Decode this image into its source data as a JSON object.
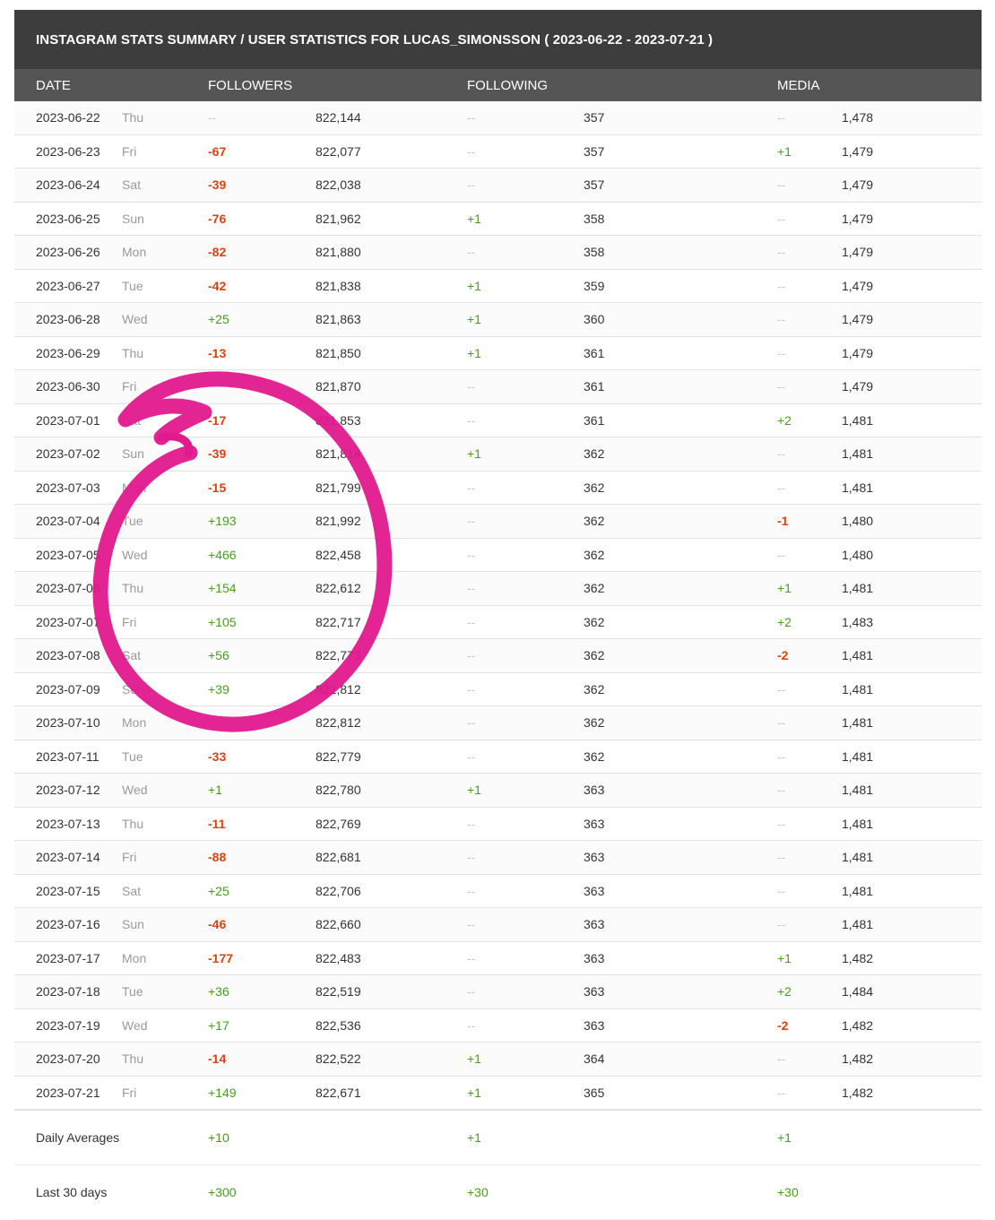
{
  "title": "INSTAGRAM STATS SUMMARY / USER STATISTICS FOR LUCAS_SIMONSSON ( 2023-06-22 - 2023-07-21 )",
  "columns": {
    "date": "DATE",
    "followers": "FOLLOWERS",
    "following": "FOLLOWING",
    "media": "MEDIA"
  },
  "colors": {
    "positive": "#43a214",
    "negative": "#e2400c",
    "header_bg": "#3d3d3d",
    "subheader_bg": "#555555",
    "annotation": "#e0198d"
  },
  "rows": [
    {
      "date": "2023-06-22",
      "day": "Thu",
      "f_chg": "--",
      "f_val": "822,144",
      "g_chg": "--",
      "g_val": "357",
      "m_chg": "--",
      "m_val": "1,478"
    },
    {
      "date": "2023-06-23",
      "day": "Fri",
      "f_chg": "-67",
      "f_val": "822,077",
      "g_chg": "--",
      "g_val": "357",
      "m_chg": "+1",
      "m_val": "1,479"
    },
    {
      "date": "2023-06-24",
      "day": "Sat",
      "f_chg": "-39",
      "f_val": "822,038",
      "g_chg": "--",
      "g_val": "357",
      "m_chg": "--",
      "m_val": "1,479"
    },
    {
      "date": "2023-06-25",
      "day": "Sun",
      "f_chg": "-76",
      "f_val": "821,962",
      "g_chg": "+1",
      "g_val": "358",
      "m_chg": "--",
      "m_val": "1,479"
    },
    {
      "date": "2023-06-26",
      "day": "Mon",
      "f_chg": "-82",
      "f_val": "821,880",
      "g_chg": "--",
      "g_val": "358",
      "m_chg": "--",
      "m_val": "1,479"
    },
    {
      "date": "2023-06-27",
      "day": "Tue",
      "f_chg": "-42",
      "f_val": "821,838",
      "g_chg": "+1",
      "g_val": "359",
      "m_chg": "--",
      "m_val": "1,479"
    },
    {
      "date": "2023-06-28",
      "day": "Wed",
      "f_chg": "+25",
      "f_val": "821,863",
      "g_chg": "+1",
      "g_val": "360",
      "m_chg": "--",
      "m_val": "1,479"
    },
    {
      "date": "2023-06-29",
      "day": "Thu",
      "f_chg": "-13",
      "f_val": "821,850",
      "g_chg": "+1",
      "g_val": "361",
      "m_chg": "--",
      "m_val": "1,479"
    },
    {
      "date": "2023-06-30",
      "day": "Fri",
      "f_chg": "",
      "f_val": "821,870",
      "g_chg": "--",
      "g_val": "361",
      "m_chg": "--",
      "m_val": "1,479"
    },
    {
      "date": "2023-07-01",
      "day": "Sat",
      "f_chg": "-17",
      "f_val": "821,853",
      "g_chg": "--",
      "g_val": "361",
      "m_chg": "+2",
      "m_val": "1,481"
    },
    {
      "date": "2023-07-02",
      "day": "Sun",
      "f_chg": "-39",
      "f_val": "821,814",
      "g_chg": "+1",
      "g_val": "362",
      "m_chg": "--",
      "m_val": "1,481"
    },
    {
      "date": "2023-07-03",
      "day": "Mon",
      "f_chg": "-15",
      "f_val": "821,799",
      "g_chg": "--",
      "g_val": "362",
      "m_chg": "--",
      "m_val": "1,481"
    },
    {
      "date": "2023-07-04",
      "day": "Tue",
      "f_chg": "+193",
      "f_val": "821,992",
      "g_chg": "--",
      "g_val": "362",
      "m_chg": "-1",
      "m_val": "1,480"
    },
    {
      "date": "2023-07-05",
      "day": "Wed",
      "f_chg": "+466",
      "f_val": "822,458",
      "g_chg": "--",
      "g_val": "362",
      "m_chg": "--",
      "m_val": "1,480"
    },
    {
      "date": "2023-07-06",
      "day": "Thu",
      "f_chg": "+154",
      "f_val": "822,612",
      "g_chg": "--",
      "g_val": "362",
      "m_chg": "+1",
      "m_val": "1,481"
    },
    {
      "date": "2023-07-07",
      "day": "Fri",
      "f_chg": "+105",
      "f_val": "822,717",
      "g_chg": "--",
      "g_val": "362",
      "m_chg": "+2",
      "m_val": "1,483"
    },
    {
      "date": "2023-07-08",
      "day": "Sat",
      "f_chg": "+56",
      "f_val": "822,773",
      "g_chg": "--",
      "g_val": "362",
      "m_chg": "-2",
      "m_val": "1,481"
    },
    {
      "date": "2023-07-09",
      "day": "Sun",
      "f_chg": "+39",
      "f_val": "822,812",
      "g_chg": "--",
      "g_val": "362",
      "m_chg": "--",
      "m_val": "1,481"
    },
    {
      "date": "2023-07-10",
      "day": "Mon",
      "f_chg": "",
      "f_val": "822,812",
      "g_chg": "--",
      "g_val": "362",
      "m_chg": "--",
      "m_val": "1,481"
    },
    {
      "date": "2023-07-11",
      "day": "Tue",
      "f_chg": "-33",
      "f_val": "822,779",
      "g_chg": "--",
      "g_val": "362",
      "m_chg": "--",
      "m_val": "1,481"
    },
    {
      "date": "2023-07-12",
      "day": "Wed",
      "f_chg": "+1",
      "f_val": "822,780",
      "g_chg": "+1",
      "g_val": "363",
      "m_chg": "--",
      "m_val": "1,481"
    },
    {
      "date": "2023-07-13",
      "day": "Thu",
      "f_chg": "-11",
      "f_val": "822,769",
      "g_chg": "--",
      "g_val": "363",
      "m_chg": "--",
      "m_val": "1,481"
    },
    {
      "date": "2023-07-14",
      "day": "Fri",
      "f_chg": "-88",
      "f_val": "822,681",
      "g_chg": "--",
      "g_val": "363",
      "m_chg": "--",
      "m_val": "1,481"
    },
    {
      "date": "2023-07-15",
      "day": "Sat",
      "f_chg": "+25",
      "f_val": "822,706",
      "g_chg": "--",
      "g_val": "363",
      "m_chg": "--",
      "m_val": "1,481"
    },
    {
      "date": "2023-07-16",
      "day": "Sun",
      "f_chg": "-46",
      "f_val": "822,660",
      "g_chg": "--",
      "g_val": "363",
      "m_chg": "--",
      "m_val": "1,481"
    },
    {
      "date": "2023-07-17",
      "day": "Mon",
      "f_chg": "-177",
      "f_val": "822,483",
      "g_chg": "--",
      "g_val": "363",
      "m_chg": "+1",
      "m_val": "1,482"
    },
    {
      "date": "2023-07-18",
      "day": "Tue",
      "f_chg": "+36",
      "f_val": "822,519",
      "g_chg": "--",
      "g_val": "363",
      "m_chg": "+2",
      "m_val": "1,484"
    },
    {
      "date": "2023-07-19",
      "day": "Wed",
      "f_chg": "+17",
      "f_val": "822,536",
      "g_chg": "--",
      "g_val": "363",
      "m_chg": "-2",
      "m_val": "1,482"
    },
    {
      "date": "2023-07-20",
      "day": "Thu",
      "f_chg": "-14",
      "f_val": "822,522",
      "g_chg": "+1",
      "g_val": "364",
      "m_chg": "--",
      "m_val": "1,482"
    },
    {
      "date": "2023-07-21",
      "day": "Fri",
      "f_chg": "+149",
      "f_val": "822,671",
      "g_chg": "+1",
      "g_val": "365",
      "m_chg": "--",
      "m_val": "1,482"
    }
  ],
  "summary": [
    {
      "label": "Daily Averages",
      "followers": "+10",
      "following": "+1",
      "media": "+1"
    },
    {
      "label": "Last 30 days",
      "followers": "+300",
      "following": "+30",
      "media": "+30"
    }
  ]
}
